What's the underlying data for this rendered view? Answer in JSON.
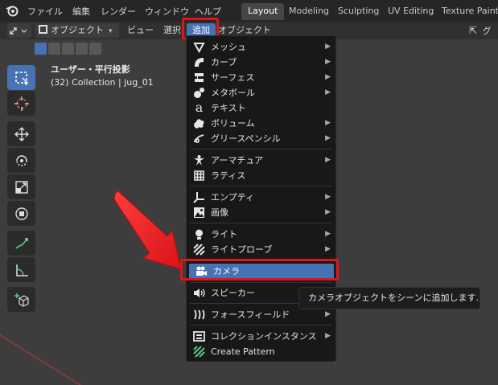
{
  "topbar": {
    "menus": [
      "ファイル",
      "編集",
      "レンダー",
      "ウィンドウ",
      "ヘルプ"
    ],
    "workspace_tabs": [
      {
        "label": "Layout",
        "active": true
      },
      {
        "label": "Modeling",
        "active": false
      },
      {
        "label": "Sculpting",
        "active": false
      },
      {
        "label": "UV Editing",
        "active": false
      },
      {
        "label": "Texture Paint",
        "active": false
      }
    ]
  },
  "header": {
    "mode_label": "オブジェクト",
    "view_label": "ビュー",
    "select_label": "選択",
    "add_label": "追加",
    "object_label": "オブジェクト",
    "right_label": "グ"
  },
  "viewport": {
    "view_title": "ユーザー・平行投影",
    "collection_info": "(32) Collection | jug_01"
  },
  "add_menu": {
    "groups": [
      [
        {
          "label": "メッシュ",
          "icon": "mesh-icon",
          "submenu": true
        },
        {
          "label": "カーブ",
          "icon": "curve-icon",
          "submenu": true
        },
        {
          "label": "サーフェス",
          "icon": "surface-icon",
          "submenu": true
        },
        {
          "label": "メタボール",
          "icon": "metaball-icon",
          "submenu": true
        },
        {
          "label": "テキスト",
          "icon": "text-icon",
          "submenu": false
        },
        {
          "label": "ボリューム",
          "icon": "volume-icon",
          "submenu": true
        },
        {
          "label": "グリースペンシル",
          "icon": "grease-pencil-icon",
          "submenu": true
        }
      ],
      [
        {
          "label": "アーマチュア",
          "icon": "armature-icon",
          "submenu": true
        },
        {
          "label": "ラティス",
          "icon": "lattice-icon",
          "submenu": false
        }
      ],
      [
        {
          "label": "エンプティ",
          "icon": "empty-icon",
          "submenu": true
        },
        {
          "label": "画像",
          "icon": "image-icon",
          "submenu": true
        }
      ],
      [
        {
          "label": "ライト",
          "icon": "light-icon",
          "submenu": true
        },
        {
          "label": "ライトプローブ",
          "icon": "light-probe-icon",
          "submenu": true
        }
      ],
      [
        {
          "label": "カメラ",
          "icon": "camera-icon",
          "submenu": false,
          "highlighted": true
        }
      ],
      [
        {
          "label": "スピーカー",
          "icon": "speaker-icon",
          "submenu": false
        }
      ],
      [
        {
          "label": "フォースフィールド",
          "icon": "force-field-icon",
          "submenu": true
        }
      ],
      [
        {
          "label": "コレクションインスタンス",
          "icon": "collection-instance-icon",
          "submenu": true
        },
        {
          "label": "Create Pattern",
          "icon": "create-pattern-icon",
          "submenu": false
        }
      ]
    ]
  },
  "tooltip": {
    "text": "カメラオブジェクトをシーンに追加します."
  },
  "colors": {
    "accent": "#4772b3",
    "annotation_red": "#e2141a",
    "menu_bg": "#181818"
  }
}
